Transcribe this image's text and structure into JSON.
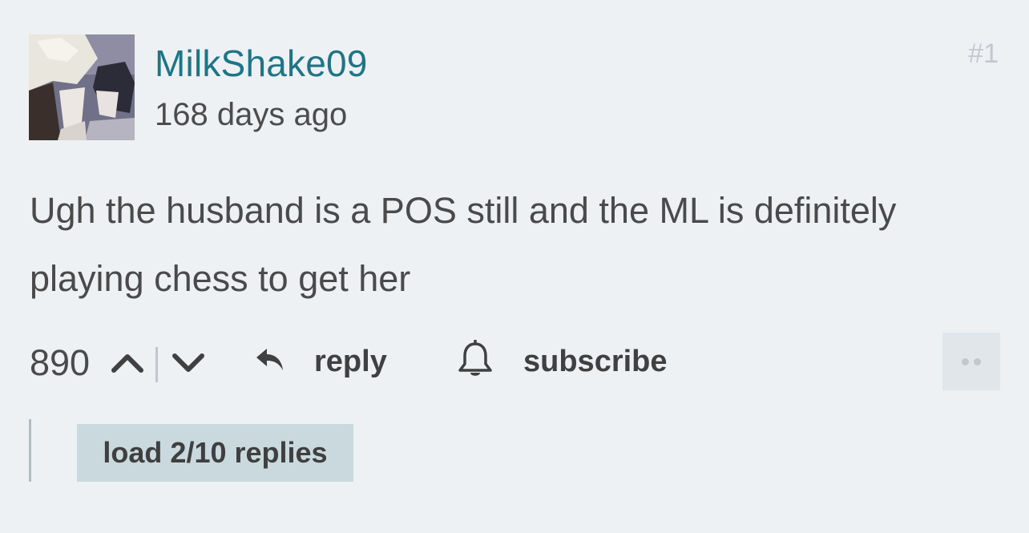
{
  "comment": {
    "username": "MilkShake09",
    "timestamp": "168 days ago",
    "comment_number": "#1",
    "body": "Ugh the husband is a POS still and the ML is definitely playing chess to get her",
    "avatar_icon": "user-avatar-image"
  },
  "actions": {
    "vote_count": "890",
    "upvote_icon": "chevron-up-icon",
    "downvote_icon": "chevron-down-icon",
    "reply_label": "reply",
    "reply_icon": "reply-arrow-icon",
    "subscribe_label": "subscribe",
    "subscribe_icon": "bell-icon",
    "more_icon": "more-dots-icon"
  },
  "replies": {
    "load_label": "load 2/10 replies"
  },
  "colors": {
    "background": "#edf1f4",
    "username": "#1e7585",
    "text": "#4a4a4a",
    "load_button_bg": "#c9d9de",
    "more_button_bg": "#e1e6ea"
  }
}
